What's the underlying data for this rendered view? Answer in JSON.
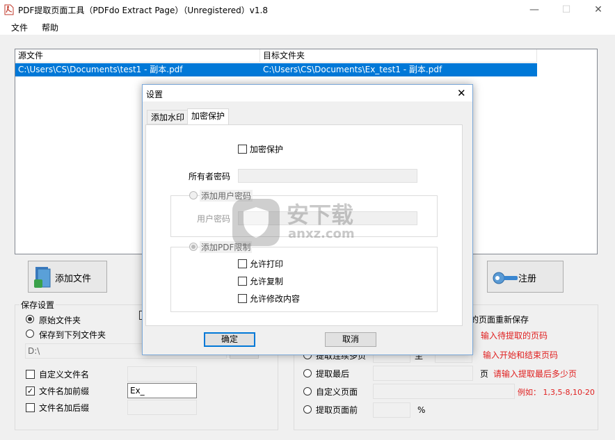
{
  "window": {
    "title": "PDF提取页面工具（PDFdo Extract Page）（Unregistered）v1.8",
    "minimize": "—",
    "maximize": "☐",
    "close": "✕"
  },
  "menu": [
    {
      "label": "文件"
    },
    {
      "label": "帮助"
    }
  ],
  "file_list": {
    "columns": [
      "源文件",
      "目标文件夹"
    ],
    "rows": [
      {
        "source": "C:\\Users\\CS\\Documents\\test1 - 副本.pdf",
        "target": "C:\\Users\\CS\\Documents\\Ex_test1 - 副本.pdf",
        "selected": true
      }
    ]
  },
  "buttons": {
    "add_file": "添加文件",
    "register": "注册"
  },
  "save_settings": {
    "title": "保存设置",
    "original_folder": "原始文件夹",
    "save_to_folder": "保存到下列文件夹",
    "folder_value": "D:\\",
    "custom_name": "自定义文件名",
    "add_prefix": "文件名加前缀",
    "prefix_value": "Ex_",
    "add_suffix": "文件名加后缀"
  },
  "extract_options": {
    "resave_fragment": "的页面重新保存",
    "hint_pages": "输入待提取的页码",
    "hint_range": "输入开始和结束页码",
    "range_fragment": "提取连续多页",
    "range_to": "至",
    "extract_last": "提取最后",
    "last_unit": "页",
    "hint_last": "请输入提取最后多少页",
    "custom_pages": "自定义页面",
    "hint_custom": "例如：  1,3,5-8,10-20",
    "extract_front": "提取页面前",
    "percent": "%"
  },
  "dialog": {
    "title": "设置",
    "close": "✕",
    "tabs": [
      {
        "label": "添加水印"
      },
      {
        "label": "加密保护"
      }
    ],
    "encrypt": "加密保护",
    "owner_password": "所有者密码",
    "add_user_password": "添加用户密码",
    "user_password": "用户密码",
    "pdf_restrictions": "添加PDF限制",
    "allow_print": "允许打印",
    "allow_copy": "允许复制",
    "allow_modify": "允许修改内容",
    "ok": "确定",
    "cancel": "取消"
  },
  "watermark": {
    "cn": "安下载",
    "en": "anxz.com"
  },
  "colors": {
    "selection": "#0078d7",
    "hint_red": "#e02020"
  }
}
